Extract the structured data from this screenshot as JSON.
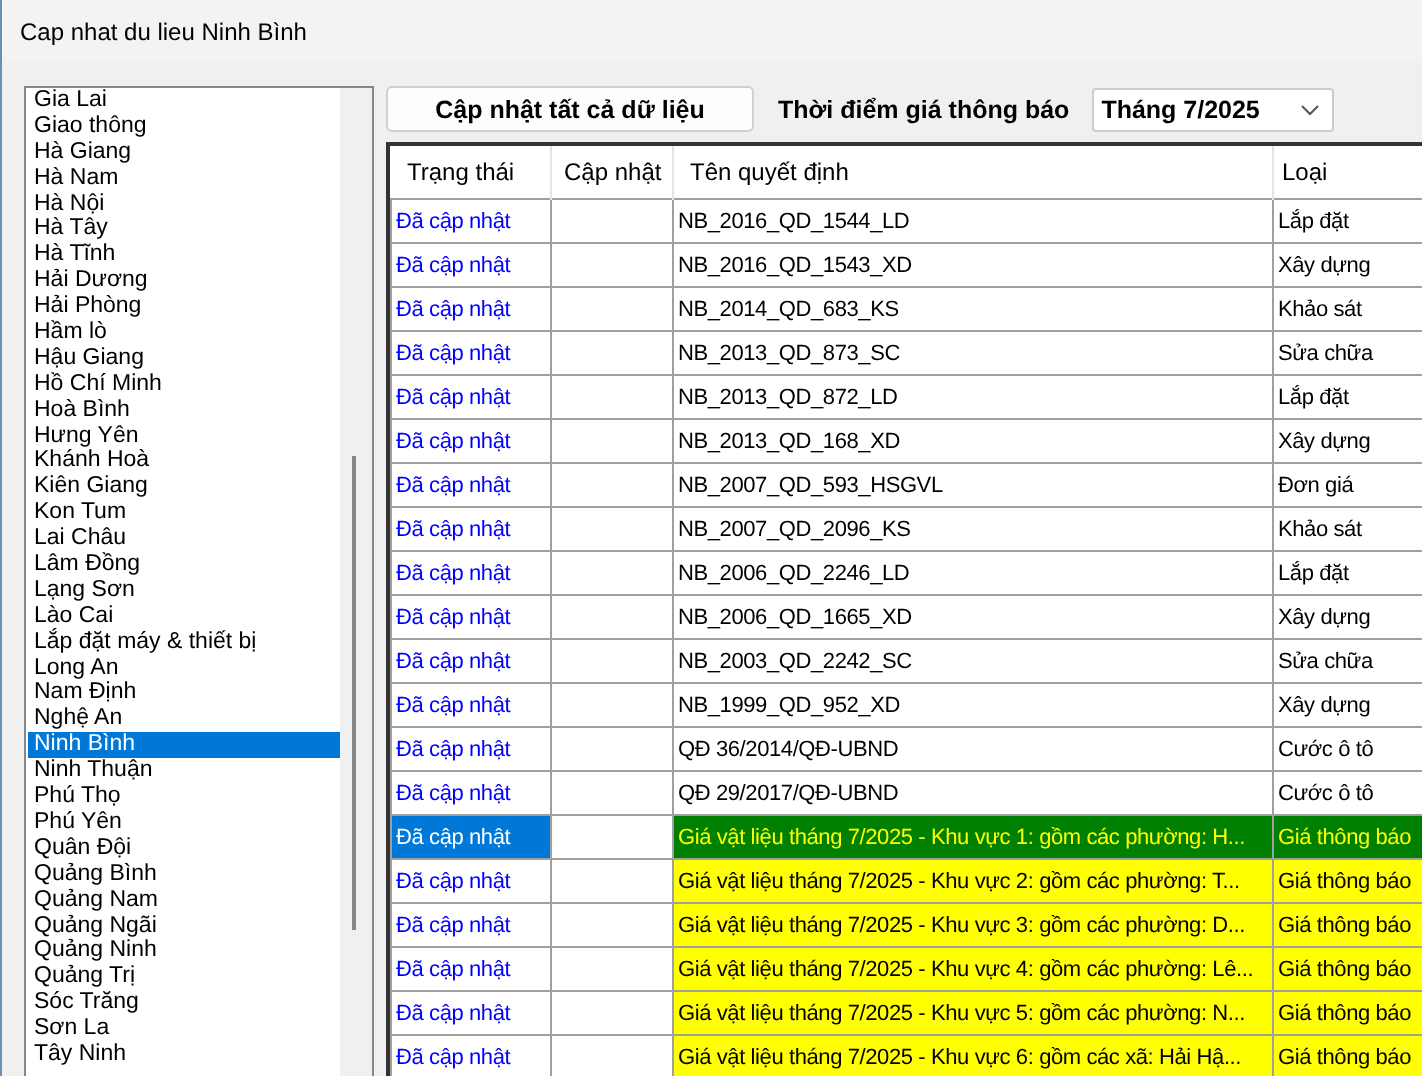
{
  "window": {
    "title": "Cap nhat du lieu Ninh Bình"
  },
  "provinces": [
    {
      "label": "Gia Lai",
      "selected": false
    },
    {
      "label": "Giao thông",
      "selected": false
    },
    {
      "label": "Hà Giang",
      "selected": false
    },
    {
      "label": "Hà Nam",
      "selected": false
    },
    {
      "label": "Hà Nội",
      "selected": false
    },
    {
      "label": "Hà Tây",
      "selected": false
    },
    {
      "label": "Hà Tĩnh",
      "selected": false
    },
    {
      "label": "Hải Dương",
      "selected": false
    },
    {
      "label": "Hải Phòng",
      "selected": false
    },
    {
      "label": "Hầm lò",
      "selected": false
    },
    {
      "label": "Hậu Giang",
      "selected": false
    },
    {
      "label": "Hồ Chí Minh",
      "selected": false
    },
    {
      "label": "Hoà Bình",
      "selected": false
    },
    {
      "label": "Hưng Yên",
      "selected": false
    },
    {
      "label": "Khánh Hoà",
      "selected": false
    },
    {
      "label": "Kiên Giang",
      "selected": false
    },
    {
      "label": "Kon Tum",
      "selected": false
    },
    {
      "label": "Lai Châu",
      "selected": false
    },
    {
      "label": "Lâm Đồng",
      "selected": false
    },
    {
      "label": "Lạng Sơn",
      "selected": false
    },
    {
      "label": "Lào Cai",
      "selected": false
    },
    {
      "label": "Lắp đặt máy & thiết bị",
      "selected": false
    },
    {
      "label": "Long An",
      "selected": false
    },
    {
      "label": "Nam Định",
      "selected": false
    },
    {
      "label": "Nghệ An",
      "selected": false
    },
    {
      "label": "Ninh Bình",
      "selected": true
    },
    {
      "label": "Ninh Thuận",
      "selected": false
    },
    {
      "label": "Phú Thọ",
      "selected": false
    },
    {
      "label": "Phú Yên",
      "selected": false
    },
    {
      "label": "Quân Đội",
      "selected": false
    },
    {
      "label": "Quảng Bình",
      "selected": false
    },
    {
      "label": "Quảng Nam",
      "selected": false
    },
    {
      "label": "Quảng Ngãi",
      "selected": false
    },
    {
      "label": "Quảng Ninh",
      "selected": false
    },
    {
      "label": "Quảng Trị",
      "selected": false
    },
    {
      "label": "Sóc Trăng",
      "selected": false
    },
    {
      "label": "Sơn La",
      "selected": false
    },
    {
      "label": "Tây Ninh",
      "selected": false
    }
  ],
  "update_all_button": "Cập nhật tất cả dữ liệu",
  "price_time": {
    "label": "Thời điểm giá thông báo",
    "value": "Tháng 7/2025"
  },
  "table": {
    "columns": [
      "Trạng thái",
      "Cập nhật",
      "Tên quyết định",
      "Loại"
    ],
    "rows": [
      {
        "status": "Đã cập nhật",
        "name": "NB_2016_QD_1544_LD",
        "type": "Lắp đặt",
        "highlighted": false,
        "selected": false
      },
      {
        "status": "Đã cập nhật",
        "name": "NB_2016_QD_1543_XD",
        "type": "Xây dựng",
        "highlighted": false,
        "selected": false
      },
      {
        "status": "Đã cập nhật",
        "name": "NB_2014_QD_683_KS",
        "type": "Khảo sát",
        "highlighted": false,
        "selected": false
      },
      {
        "status": "Đã cập nhật",
        "name": "NB_2013_QD_873_SC",
        "type": "Sửa chữa",
        "highlighted": false,
        "selected": false
      },
      {
        "status": "Đã cập nhật",
        "name": "NB_2013_QD_872_LD",
        "type": "Lắp đặt",
        "highlighted": false,
        "selected": false
      },
      {
        "status": "Đã cập nhật",
        "name": "NB_2013_QD_168_XD",
        "type": "Xây dựng",
        "highlighted": false,
        "selected": false
      },
      {
        "status": "Đã cập nhật",
        "name": "NB_2007_QD_593_HSGVL",
        "type": "Đơn giá",
        "highlighted": false,
        "selected": false
      },
      {
        "status": "Đã cập nhật",
        "name": "NB_2007_QD_2096_KS",
        "type": "Khảo sát",
        "highlighted": false,
        "selected": false
      },
      {
        "status": "Đã cập nhật",
        "name": "NB_2006_QD_2246_LD",
        "type": "Lắp đặt",
        "highlighted": false,
        "selected": false
      },
      {
        "status": "Đã cập nhật",
        "name": "NB_2006_QD_1665_XD",
        "type": "Xây dựng",
        "highlighted": false,
        "selected": false
      },
      {
        "status": "Đã cập nhật",
        "name": "NB_2003_QD_2242_SC",
        "type": "Sửa chữa",
        "highlighted": false,
        "selected": false
      },
      {
        "status": "Đã cập nhật",
        "name": "NB_1999_QD_952_XD",
        "type": "Xây dựng",
        "highlighted": false,
        "selected": false
      },
      {
        "status": "Đã cập nhật",
        "name": "QĐ 36/2014/QĐ-UBND",
        "type": "Cước ô tô",
        "highlighted": false,
        "selected": false
      },
      {
        "status": "Đã cập nhật",
        "name": "QĐ 29/2017/QĐ-UBND",
        "type": "Cước ô tô",
        "highlighted": false,
        "selected": false
      },
      {
        "status": "Đã cập nhật",
        "name": "Giá vật liệu tháng 7/2025 - Khu vực 1: gồm các phường: H...",
        "type": "Giá thông báo",
        "highlighted": true,
        "selected": true
      },
      {
        "status": "Đã cập nhật",
        "name": "Giá vật liệu tháng 7/2025 - Khu vực 2: gồm các phường: T...",
        "type": "Giá thông báo",
        "highlighted": true,
        "selected": false
      },
      {
        "status": "Đã cập nhật",
        "name": "Giá vật liệu tháng 7/2025 - Khu vực 3: gồm các phường: D...",
        "type": "Giá thông báo",
        "highlighted": true,
        "selected": false
      },
      {
        "status": "Đã cập nhật",
        "name": "Giá vật liệu tháng 7/2025 - Khu vực 4: gồm các phường: Lê...",
        "type": "Giá thông báo",
        "highlighted": true,
        "selected": false
      },
      {
        "status": "Đã cập nhật",
        "name": "Giá vật liệu tháng 7/2025 - Khu vực 5: gồm các phường: N...",
        "type": "Giá thông báo",
        "highlighted": true,
        "selected": false
      },
      {
        "status": "Đã cập nhật",
        "name": "Giá vật liệu tháng 7/2025 - Khu vực 6: gồm các xã: Hải Hậ...",
        "type": "Giá thông báo",
        "highlighted": true,
        "selected": false
      }
    ]
  }
}
